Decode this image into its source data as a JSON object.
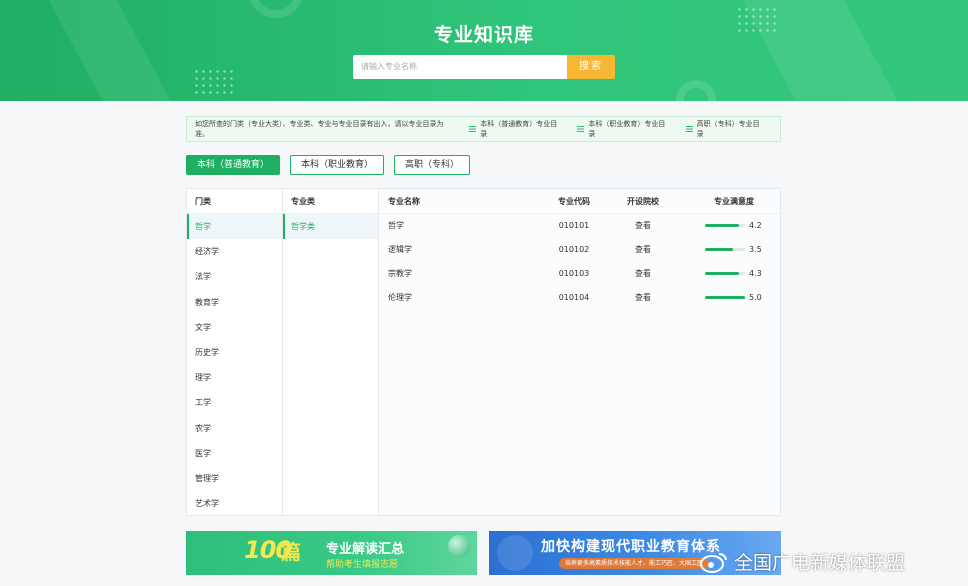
{
  "header": {
    "title": "专业知识库",
    "search_placeholder": "请输入专业名称",
    "search_button": "搜索"
  },
  "notice": {
    "message": "如您所查的门类（专业大类）、专业类、专业与专业目录有出入，请以专业目录为准。",
    "links": [
      "本科（普通教育）专业目录",
      "本科（职业教育）专业目录",
      "高职（专科）专业目录"
    ]
  },
  "tabs": [
    {
      "label": "本科（普通教育）",
      "active": true
    },
    {
      "label": "本科（职业教育）",
      "active": false
    },
    {
      "label": "高职（专科）",
      "active": false
    }
  ],
  "categories": {
    "header": "门类",
    "items": [
      "哲学",
      "经济学",
      "法学",
      "教育学",
      "文学",
      "历史学",
      "理学",
      "工学",
      "农学",
      "医学",
      "管理学",
      "艺术学"
    ],
    "selected": "哲学"
  },
  "subcategories": {
    "header": "专业类",
    "items": [
      "哲学类"
    ],
    "selected": "哲学类"
  },
  "majors": {
    "columns": [
      "专业名称",
      "专业代码",
      "开设院校",
      "专业满意度"
    ],
    "rows": [
      {
        "name": "哲学",
        "code": "010101",
        "action": "查看",
        "satisfaction": 4.2
      },
      {
        "name": "逻辑学",
        "code": "010102",
        "action": "查看",
        "satisfaction": 3.5
      },
      {
        "name": "宗教学",
        "code": "010103",
        "action": "查看",
        "satisfaction": 4.3
      },
      {
        "name": "伦理学",
        "code": "010104",
        "action": "查看",
        "satisfaction": 5.0
      }
    ],
    "satisfaction_max": 5
  },
  "promos": {
    "left": {
      "number": "100",
      "unit": "篇",
      "title": "专业解读汇总",
      "subtitle": "帮助考生填报志愿"
    },
    "right": {
      "title": "加快构建现代职业教育体系",
      "subtitle": "培养更多高素质技术技能人才、能工巧匠、大国工匠"
    }
  },
  "watermark": {
    "text": "全国广电新媒体联盟"
  },
  "colors": {
    "brand": "#1fae62",
    "search_button": "#f7b733",
    "promo_highlight": "#f5e84c"
  }
}
